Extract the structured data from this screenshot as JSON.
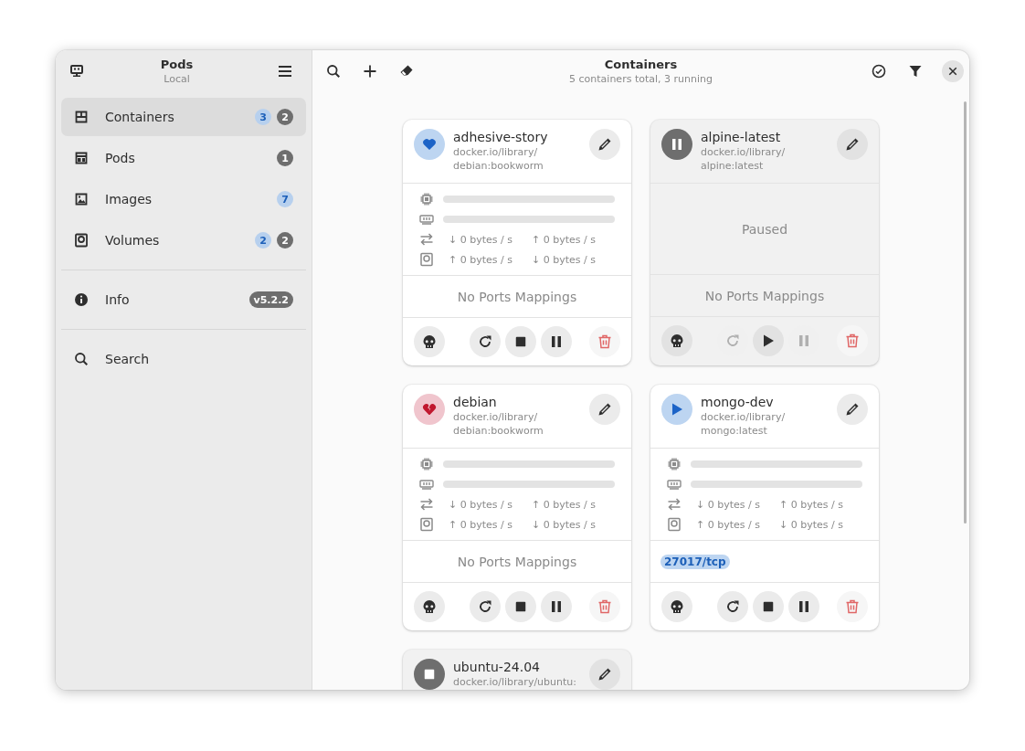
{
  "sidebar": {
    "title": "Pods",
    "subtitle": "Local",
    "items": [
      {
        "kind": "containers",
        "label": "Containers",
        "selected": true,
        "badges": [
          {
            "text": "3",
            "kind": "accent"
          },
          {
            "text": "2",
            "kind": "neutral"
          }
        ]
      },
      {
        "kind": "pods",
        "label": "Pods",
        "selected": false,
        "badges": [
          {
            "text": "1",
            "kind": "neutral"
          }
        ]
      },
      {
        "kind": "images",
        "label": "Images",
        "selected": false,
        "badges": [
          {
            "text": "7",
            "kind": "accent"
          }
        ]
      },
      {
        "kind": "volumes",
        "label": "Volumes",
        "selected": false,
        "badges": [
          {
            "text": "2",
            "kind": "accent"
          },
          {
            "text": "2",
            "kind": "neutral"
          }
        ]
      }
    ],
    "info": {
      "label": "Info",
      "badge": "v5.2.2"
    },
    "search": {
      "label": "Search"
    }
  },
  "header": {
    "title": "Containers",
    "subtitle": "5 containers total, 3 running"
  },
  "containers": [
    {
      "name": "adhesive-story",
      "image": [
        "docker.io/library/",
        "debian:bookworm"
      ],
      "kind": "healthy",
      "stats": {
        "cpu": {
          "level": 0
        },
        "memory": {
          "level": 0
        },
        "net_down": "↓ 0 bytes / s",
        "net_up": "↑ 0 bytes / s",
        "disk_up": "↑ 0 bytes / s",
        "disk_down": "↓ 0 bytes / s"
      },
      "no_ports": "No Ports Mappings",
      "actions": [
        {
          "kind": "kill",
          "disabled": false
        },
        {
          "kind": "restart",
          "disabled": false
        },
        {
          "kind": "stop",
          "disabled": false
        },
        {
          "kind": "pause",
          "disabled": false
        },
        {
          "kind": "delete",
          "disabled": false
        }
      ]
    },
    {
      "name": "alpine-latest",
      "image": [
        "docker.io/library/",
        "alpine:latest"
      ],
      "kind": "paused",
      "message": "Paused",
      "no_ports": "No Ports Mappings",
      "actions": [
        {
          "kind": "kill",
          "disabled": false
        },
        {
          "kind": "restart",
          "disabled": true
        },
        {
          "kind": "start",
          "disabled": false
        },
        {
          "kind": "pause",
          "disabled": true
        },
        {
          "kind": "delete",
          "disabled": false
        }
      ]
    },
    {
      "name": "debian",
      "image": [
        "docker.io/library/",
        "debian:bookworm"
      ],
      "kind": "unhealthy",
      "stats": {
        "cpu": {
          "level": 0
        },
        "memory": {
          "level": 0
        },
        "net_down": "↓ 0 bytes / s",
        "net_up": "↑ 0 bytes / s",
        "disk_up": "↑ 0 bytes / s",
        "disk_down": "↓ 0 bytes / s"
      },
      "no_ports": "No Ports Mappings",
      "actions": [
        {
          "kind": "kill",
          "disabled": false
        },
        {
          "kind": "restart",
          "disabled": false
        },
        {
          "kind": "stop",
          "disabled": false
        },
        {
          "kind": "pause",
          "disabled": false
        },
        {
          "kind": "delete",
          "disabled": false
        }
      ]
    },
    {
      "name": "mongo-dev",
      "image": [
        "docker.io/library/",
        "mongo:latest"
      ],
      "kind": "running",
      "stats": {
        "cpu": {
          "level": 0
        },
        "memory": {
          "level": 0
        },
        "net_down": "↓ 0 bytes / s",
        "net_up": "↑ 0 bytes / s",
        "disk_up": "↑ 0 bytes / s",
        "disk_down": "↓ 0 bytes / s"
      },
      "ports": [
        "27017/tcp"
      ],
      "actions": [
        {
          "kind": "kill",
          "disabled": false
        },
        {
          "kind": "restart",
          "disabled": false
        },
        {
          "kind": "stop",
          "disabled": false
        },
        {
          "kind": "pause",
          "disabled": false
        },
        {
          "kind": "delete",
          "disabled": false
        }
      ]
    },
    {
      "name": "ubuntu-24.04",
      "image": [
        "docker.io/library/ubuntu:"
      ],
      "kind": "stopped"
    }
  ]
}
